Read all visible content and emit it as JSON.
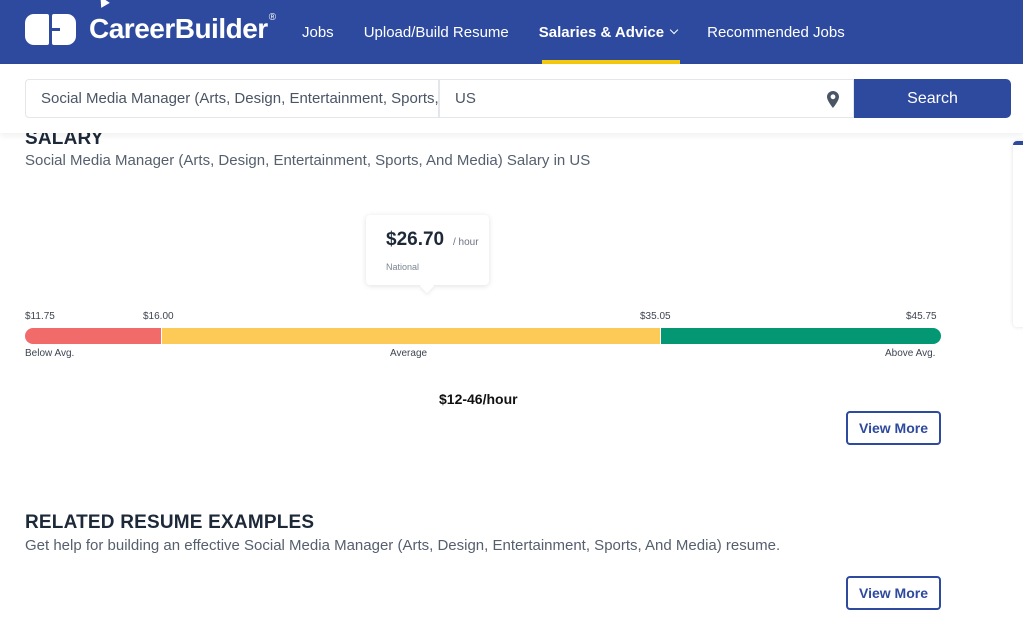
{
  "header": {
    "brand": "CareerBuilder",
    "brand_mark": "®",
    "nav": [
      {
        "label": "Jobs",
        "active": false
      },
      {
        "label": "Upload/Build Resume",
        "active": false
      },
      {
        "label": "Salaries & Advice",
        "active": true,
        "has_dropdown": true
      },
      {
        "label": "Recommended Jobs",
        "active": false
      }
    ],
    "colors": {
      "brand": "#2e4a9e",
      "active_underline": "#f2c811"
    }
  },
  "search": {
    "job_value": "Social Media Manager (Arts, Design, Entertainment, Sports, And Media)",
    "location_value": "US",
    "location_icon": "map-pin-icon",
    "button_label": "Search"
  },
  "salary": {
    "title": "SALARY",
    "subtitle": "Social Media Manager (Arts, Design, Entertainment, Sports, And Media) Salary in US",
    "tooltip": {
      "value": "$26.70",
      "unit": "/ hour",
      "scope": "National"
    },
    "ticks": {
      "min": "$11.75",
      "low": "$16.00",
      "high": "$35.05",
      "max": "$45.75"
    },
    "bands": [
      {
        "label": "Below Avg.",
        "from": 11.75,
        "to": 16.0,
        "color": "#f26b6b"
      },
      {
        "label": "Average",
        "from": 16.0,
        "to": 35.05,
        "color": "#fdca57"
      },
      {
        "label": "Above Avg.",
        "from": 35.05,
        "to": 45.75,
        "color": "#039873"
      }
    ],
    "range_text": "$12-46/hour",
    "view_more_label": "View More"
  },
  "resume_examples": {
    "title": "RELATED RESUME EXAMPLES",
    "subtitle": "Get help for building an effective Social Media Manager (Arts, Design, Entertainment, Sports, And Media) resume.",
    "view_more_label": "View More"
  }
}
